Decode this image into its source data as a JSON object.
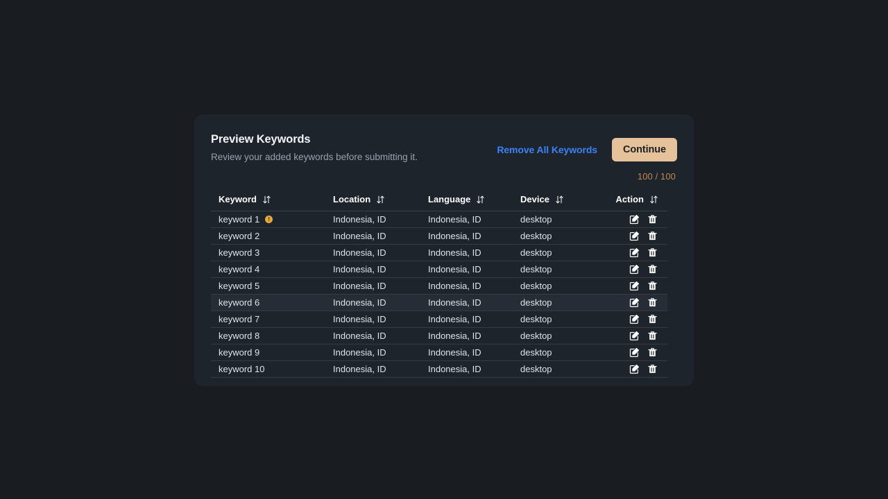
{
  "card": {
    "title": "Preview Keywords",
    "subtitle": "Review your added keywords before submitting it.",
    "remove_all_label": "Remove All Keywords",
    "continue_label": "Continue",
    "counter": "100 / 100",
    "accent_blue": "#3b82f6",
    "accent_tan": "#e6c29b",
    "accent_orange": "#c08a4e",
    "badge_amber": "#e8a93a",
    "card_bg": "#1e242c",
    "page_bg": "#191c21"
  },
  "table": {
    "columns": [
      {
        "label": "Keyword",
        "sort_icon": "sort-icon"
      },
      {
        "label": "Location",
        "sort_icon": "sort-icon"
      },
      {
        "label": "Language",
        "sort_icon": "sort-icon"
      },
      {
        "label": "Device",
        "sort_icon": "sort-icon"
      },
      {
        "label": "Action",
        "sort_icon": "sort-icon"
      }
    ],
    "row_actions": [
      {
        "name": "edit-icon",
        "label": "Edit"
      },
      {
        "name": "delete-icon",
        "label": "Delete"
      }
    ],
    "rows": [
      {
        "keyword": "keyword 1",
        "location": "Indonesia, ID",
        "language": "Indonesia, ID",
        "device": "desktop",
        "warning": "!",
        "hovered": false
      },
      {
        "keyword": "keyword 2",
        "location": "Indonesia, ID",
        "language": "Indonesia, ID",
        "device": "desktop",
        "warning": null,
        "hovered": false
      },
      {
        "keyword": "keyword 3",
        "location": "Indonesia, ID",
        "language": "Indonesia, ID",
        "device": "desktop",
        "warning": null,
        "hovered": false
      },
      {
        "keyword": "keyword 4",
        "location": "Indonesia, ID",
        "language": "Indonesia, ID",
        "device": "desktop",
        "warning": null,
        "hovered": false
      },
      {
        "keyword": "keyword 5",
        "location": "Indonesia, ID",
        "language": "Indonesia, ID",
        "device": "desktop",
        "warning": null,
        "hovered": false
      },
      {
        "keyword": "keyword 6",
        "location": "Indonesia, ID",
        "language": "Indonesia, ID",
        "device": "desktop",
        "warning": null,
        "hovered": true
      },
      {
        "keyword": "keyword 7",
        "location": "Indonesia, ID",
        "language": "Indonesia, ID",
        "device": "desktop",
        "warning": null,
        "hovered": false
      },
      {
        "keyword": "keyword 8",
        "location": "Indonesia, ID",
        "language": "Indonesia, ID",
        "device": "desktop",
        "warning": null,
        "hovered": false
      },
      {
        "keyword": "keyword 9",
        "location": "Indonesia, ID",
        "language": "Indonesia, ID",
        "device": "desktop",
        "warning": null,
        "hovered": false
      },
      {
        "keyword": "keyword 10",
        "location": "Indonesia, ID",
        "language": "Indonesia, ID",
        "device": "desktop",
        "warning": null,
        "hovered": false
      }
    ]
  }
}
